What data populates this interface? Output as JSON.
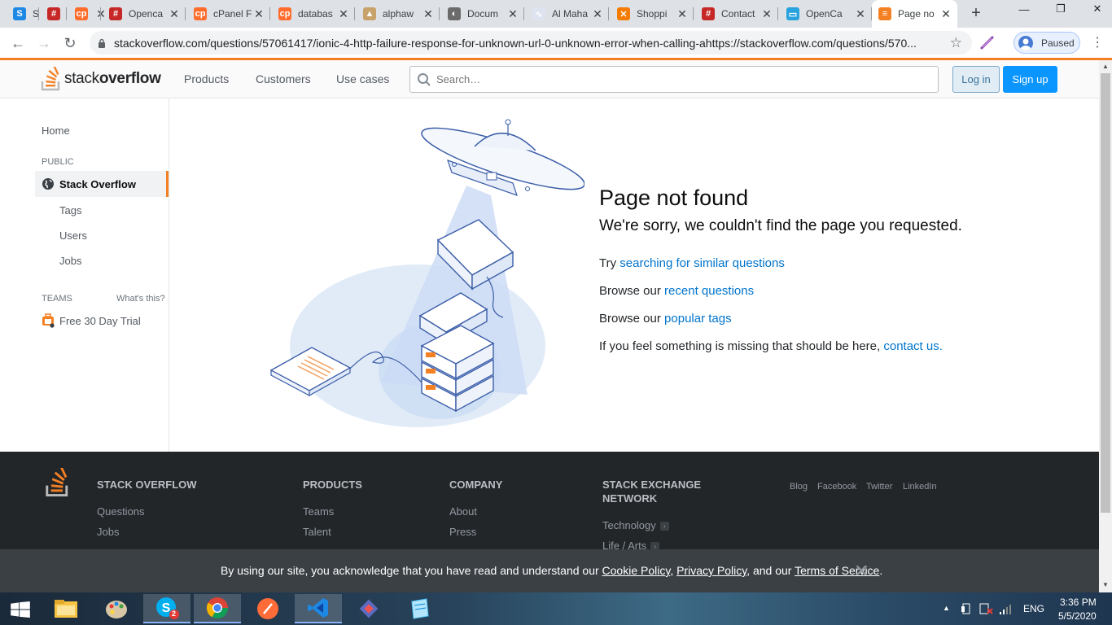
{
  "browser": {
    "tabs": [
      {
        "label": "S",
        "fav_color": "#1e88e5",
        "fav_text": "S"
      },
      {
        "label": "",
        "fav_color": "#c62828",
        "fav_text": "#"
      },
      {
        "label": "",
        "fav_color": "#ff6c2c",
        "fav_text": "cp"
      },
      {
        "label": "Openca",
        "fav_color": "#c62828",
        "fav_text": "#"
      },
      {
        "label": "cPanel F",
        "fav_color": "#ff6c2c",
        "fav_text": "cp"
      },
      {
        "label": "databas",
        "fav_color": "#ff6c2c",
        "fav_text": "cp"
      },
      {
        "label": "alphaw",
        "fav_color": "#c8a26b",
        "fav_text": "▲"
      },
      {
        "label": "Docum",
        "fav_color": "#6b6b6b",
        "fav_text": "◐"
      },
      {
        "label": "Al Maha",
        "fav_color": "#dde3ef",
        "fav_text": "∿"
      },
      {
        "label": "Shoppi",
        "fav_color": "#f57c00",
        "fav_text": "✕"
      },
      {
        "label": "Contact",
        "fav_color": "#c62828",
        "fav_text": "#"
      },
      {
        "label": "OpenCa",
        "fav_color": "#29a3dd",
        "fav_text": "▭"
      },
      {
        "label": "Page no",
        "fav_color": "#f48024",
        "fav_text": "≡"
      }
    ],
    "url": "stackoverflow.com/questions/57061417/ionic-4-http-failure-response-for-unknown-url-0-unknown-error-when-calling-ahttps://stackoverflow.com/questions/570...",
    "profile_label": "Paused"
  },
  "so": {
    "logo_light": "stack",
    "logo_bold": "overflow",
    "nav": [
      "Products",
      "Customers",
      "Use cases"
    ],
    "search_placeholder": "Search…",
    "login": "Log in",
    "signup": "Sign up"
  },
  "sidebar": {
    "home": "Home",
    "public_head": "PUBLIC",
    "active": "Stack Overflow",
    "items": [
      "Tags",
      "Users",
      "Jobs"
    ],
    "teams_head": "TEAMS",
    "whats_this": "What's this?",
    "trial": "Free 30 Day Trial"
  },
  "notfound": {
    "title": "Page not found",
    "subtitle": "We're sorry, we couldn't find the page you requested.",
    "line1_pre": "Try ",
    "line1_link": "searching for similar questions",
    "line2_pre": "Browse our ",
    "line2_link": "recent questions",
    "line3_pre": "Browse our ",
    "line3_link": "popular tags",
    "line4_pre": "If you feel something is missing that should be here, ",
    "line4_link": "contact us."
  },
  "footer": {
    "col1_head": "STACK OVERFLOW",
    "col1_links": [
      "Questions",
      "Jobs"
    ],
    "col2_head": "PRODUCTS",
    "col2_links": [
      "Teams",
      "Talent"
    ],
    "col3_head": "COMPANY",
    "col3_links": [
      "About",
      "Press"
    ],
    "col4_head_1": "STACK EXCHANGE",
    "col4_head_2": "NETWORK",
    "col4_links": [
      "Technology",
      "Life / Arts"
    ],
    "social": [
      "Blog",
      "Facebook",
      "Twitter",
      "LinkedIn"
    ]
  },
  "cookie": {
    "pre": "By using our site, you acknowledge that you have read and understand our ",
    "cookie_policy": "Cookie Policy",
    "comma": ", ",
    "privacy_policy": "Privacy Policy",
    "and_our": ", and our ",
    "terms": "Terms of Service",
    "period": "."
  },
  "taskbar": {
    "lang": "ENG",
    "time": "3:36 PM",
    "date": "5/5/2020",
    "skype_badge": "2"
  },
  "colors": {
    "accent_orange": "#f48024",
    "link_blue": "#0074cc",
    "signup_blue": "#0a95ff"
  }
}
